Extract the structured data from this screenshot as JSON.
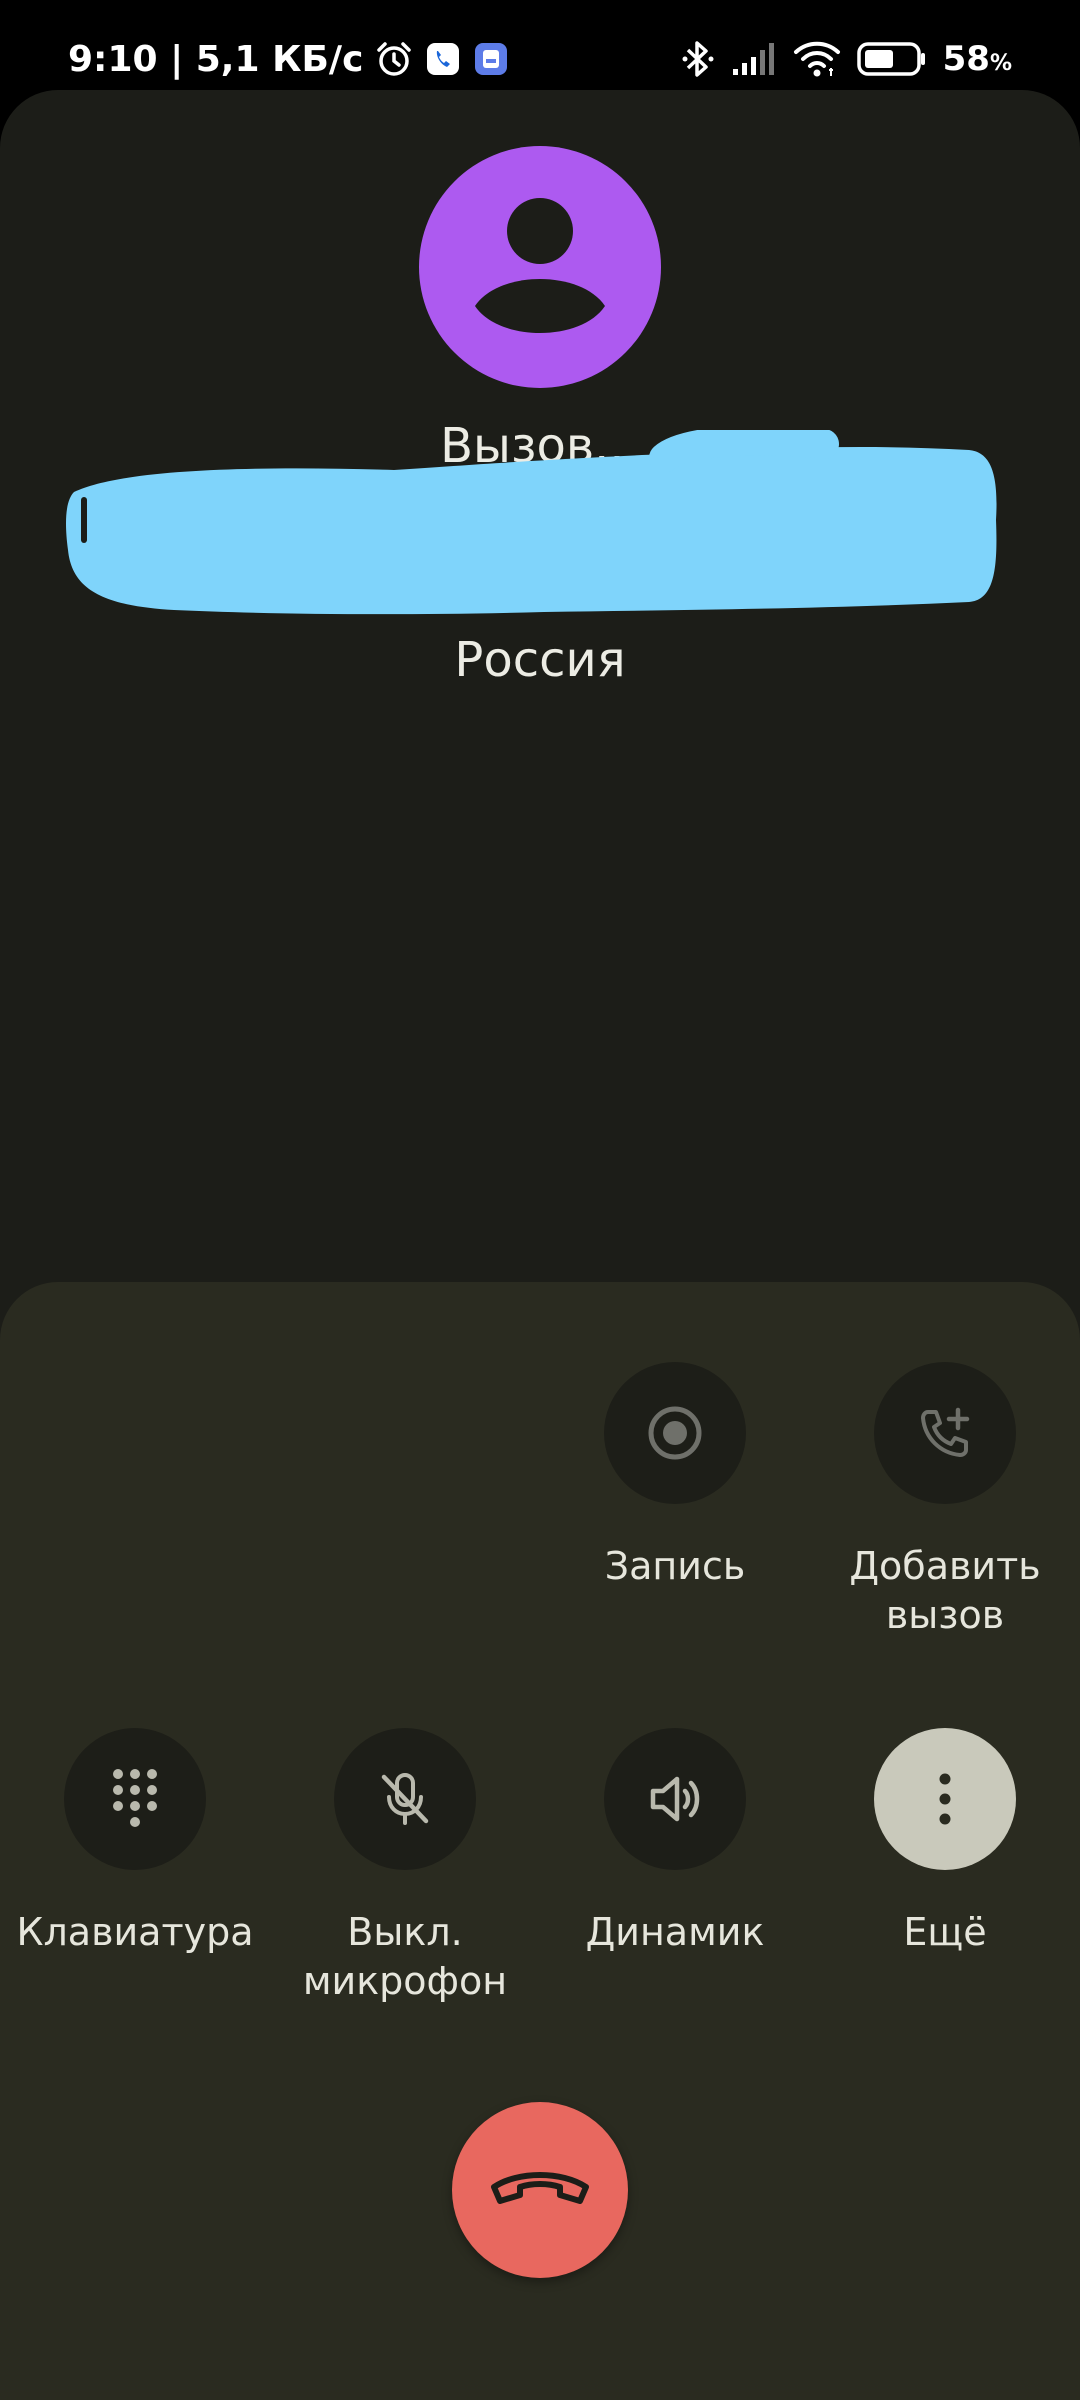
{
  "status_bar": {
    "time": "9:10 | 5,1 КБ/с",
    "battery_percent": "58",
    "battery_unit": "%",
    "battery_level": 0.58,
    "icons": [
      "alarm-icon",
      "phone-app-icon",
      "notification-app-icon",
      "bluetooth-icon",
      "signal-icon",
      "wifi-icon",
      "battery-icon"
    ]
  },
  "call": {
    "status": "Вызов...",
    "location": "Россия",
    "avatar_color": "#ad5af0",
    "redaction_color": "#7fd4fb"
  },
  "controls": {
    "record": {
      "label": "Запись",
      "icon": "record-icon"
    },
    "add_call": {
      "label": "Добавить\nвызов",
      "icon": "add-call-icon"
    },
    "keypad": {
      "label": "Клавиатура",
      "icon": "dialpad-icon"
    },
    "mute": {
      "label": "Выкл.\nмикрофон",
      "icon": "mic-off-icon"
    },
    "speaker": {
      "label": "Динамик",
      "icon": "speaker-icon"
    },
    "more": {
      "label": "Ещё",
      "icon": "more-vert-icon"
    },
    "end_call": {
      "icon": "end-call-icon",
      "color": "#e8685f"
    }
  }
}
